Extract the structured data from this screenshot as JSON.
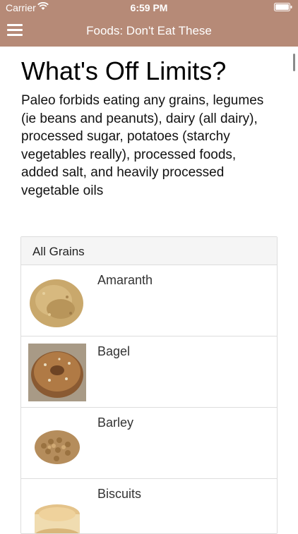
{
  "status_bar": {
    "carrier": "Carrier",
    "time": "6:59 PM",
    "wifi_icon": "wifi-icon",
    "battery_icon": "battery-icon"
  },
  "nav": {
    "title": "Foods: Don't Eat These",
    "menu_icon": "hamburger-menu-icon"
  },
  "colors": {
    "nav_background": "#b68a77",
    "panel_heading": "#f5f5f5",
    "panel_border": "#dddddd"
  },
  "page": {
    "headline": "What's Off Limits?",
    "intro": "Paleo forbids eating any grains, legumes (ie beans and peanuts), dairy (all dairy), processed sugar, potatoes (starchy vegetables really), processed foods, added salt, and heavily processed vegetable oils"
  },
  "grains_panel": {
    "heading": "All Grains",
    "items": [
      {
        "label": "Amaranth",
        "image": "amaranth-photo"
      },
      {
        "label": "Bagel",
        "image": "bagel-photo"
      },
      {
        "label": "Barley",
        "image": "barley-photo"
      },
      {
        "label": "Biscuits",
        "image": "biscuits-photo"
      }
    ]
  }
}
